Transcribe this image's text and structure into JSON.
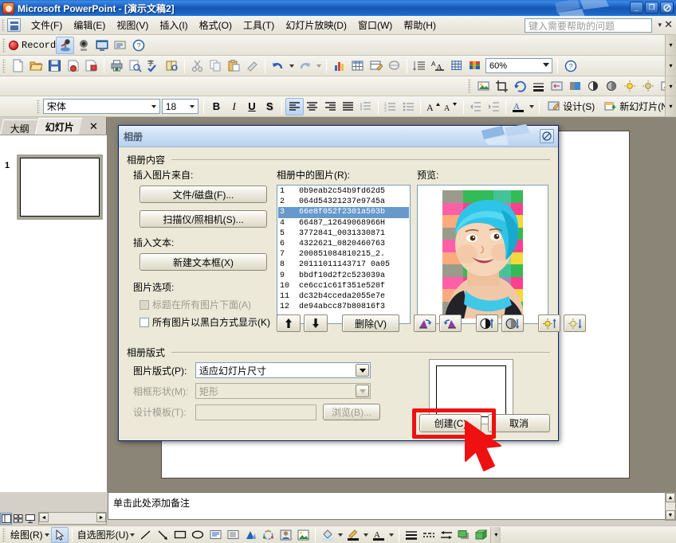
{
  "window": {
    "title": "Microsoft PowerPoint - [演示文稿2]",
    "app_icon": "powerpoint-icon",
    "minimize": "_",
    "restore": "❐",
    "close": "✕"
  },
  "menubar": {
    "items": [
      {
        "label": "文件(F)",
        "name": "menu-file"
      },
      {
        "label": "编辑(E)",
        "name": "menu-edit"
      },
      {
        "label": "视图(V)",
        "name": "menu-view"
      },
      {
        "label": "插入(I)",
        "name": "menu-insert"
      },
      {
        "label": "格式(O)",
        "name": "menu-format"
      },
      {
        "label": "工具(T)",
        "name": "menu-tools"
      },
      {
        "label": "幻灯片放映(D)",
        "name": "menu-slideshow"
      },
      {
        "label": "窗口(W)",
        "name": "menu-window"
      },
      {
        "label": "帮助(H)",
        "name": "menu-help"
      }
    ],
    "ask_placeholder": "键入需要帮助的问题",
    "close_doc": "✕"
  },
  "record_toolbar": {
    "label": "Record",
    "buttons": [
      "record-dot-button",
      "microphone-icon",
      "webcam-icon",
      "screen-capture-icon",
      "annotate-icon",
      "help-icon"
    ]
  },
  "standard_toolbar": {
    "zoom_value": "60%",
    "buttons": [
      "new-icon",
      "open-icon",
      "save-icon",
      "mail-icon",
      "permission-icon",
      "print-icon",
      "print-preview-icon",
      "spelling-icon",
      "research-icon",
      "cut-icon",
      "copy-icon",
      "paste-icon",
      "format-painter-icon",
      "undo-icon",
      "redo-icon",
      "insert-table-icon",
      "insert-chart-icon",
      "table-icon",
      "insert-diagram-icon",
      "hyperlink-icon",
      "expand-all-icon",
      "show-formatting-icon",
      "grid-icon",
      "color-scheme-icon",
      "help-icon"
    ]
  },
  "format_toolbar": {
    "font_name": "宋体",
    "font_size": "18",
    "bold": "B",
    "italic": "I",
    "underline": "U",
    "shadow": "S",
    "design_label": "设计(S)",
    "new_slide_label": "新幻灯片(N)"
  },
  "left_pane": {
    "tab_outline": "大纲",
    "tab_slides": "幻灯片",
    "close": "✕",
    "slide_number": "1"
  },
  "notes": {
    "placeholder": "单击此处添加备注"
  },
  "drawing_toolbar": {
    "draw_label": "绘图(R)",
    "autoshapes_label": "自选图形(U)",
    "buttons": [
      "select-arrow-icon",
      "line-icon",
      "arrow-icon",
      "rectangle-icon",
      "oval-icon",
      "text-box-icon",
      "vertical-text-box-icon",
      "wordart-icon",
      "diagram-icon",
      "clip-art-icon",
      "picture-icon",
      "fill-color-icon",
      "line-color-icon",
      "font-color-icon",
      "line-style-icon",
      "dash-style-icon",
      "arrow-style-icon",
      "shadow-style-icon",
      "3d-style-icon"
    ]
  },
  "dialog": {
    "title": "相册",
    "help_icon": "help-icon",
    "content_group": "相册内容",
    "insert_picture_from_label": "插入图片来自:",
    "btn_file_disk": "文件/磁盘(F)...",
    "btn_scanner_camera": "扫描仪/照相机(S)...",
    "insert_text_label": "插入文本:",
    "btn_new_textbox": "新建文本框(X)",
    "picture_options_label": "图片选项:",
    "chk_captions_below": "标题在所有图片下面(A)",
    "chk_captions_below_checked": false,
    "chk_captions_below_disabled": true,
    "chk_black_white": "所有图片以黑白方式显示(K)",
    "chk_black_white_checked": false,
    "pictures_in_album_label": "相册中的图片(R):",
    "preview_label": "预览:",
    "pictures": [
      {
        "index": "1",
        "name": "0b9eab2c54b9fd62d5"
      },
      {
        "index": "2",
        "name": "064d54321237e9745a"
      },
      {
        "index": "3",
        "name": "66e8f052f2301a503b"
      },
      {
        "index": "4",
        "name": "66487_12649068966H"
      },
      {
        "index": "5",
        "name": "3772841_0031330871"
      },
      {
        "index": "6",
        "name": "4322621_0820460763"
      },
      {
        "index": "7",
        "name": "200851084810215_2."
      },
      {
        "index": "8",
        "name": "20111011143717 0a05"
      },
      {
        "index": "9",
        "name": "bbdf10d2f2c523039a"
      },
      {
        "index": "10",
        "name": "ce6cc1c61f351e520f"
      },
      {
        "index": "11",
        "name": "dc32b4cceda2055e7e"
      },
      {
        "index": "12",
        "name": "de94abcc87b80816f3"
      }
    ],
    "selected_picture_index": 2,
    "list_buttons": {
      "move_up": "move-up-icon",
      "move_down": "move-down-icon",
      "remove": "删除(V)",
      "rotate_left": "rotate-left-icon",
      "rotate_right": "rotate-right-icon",
      "contrast_more": "increase-contrast-icon",
      "contrast_less": "decrease-contrast-icon",
      "brightness_more": "increase-brightness-icon",
      "brightness_less": "decrease-brightness-icon"
    },
    "layout_group": "相册版式",
    "picture_layout_label": "图片版式(P):",
    "picture_layout_value": "适应幻灯片尺寸",
    "frame_shape_label": "相框形状(M):",
    "frame_shape_value": "矩形",
    "frame_shape_disabled": true,
    "design_template_label": "设计模板(T):",
    "design_template_value": "",
    "btn_browse": "浏览(B)...",
    "btn_browse_disabled": true,
    "btn_create": "创建(C)",
    "btn_cancel": "取消",
    "highlight_color": "#ee1111"
  }
}
